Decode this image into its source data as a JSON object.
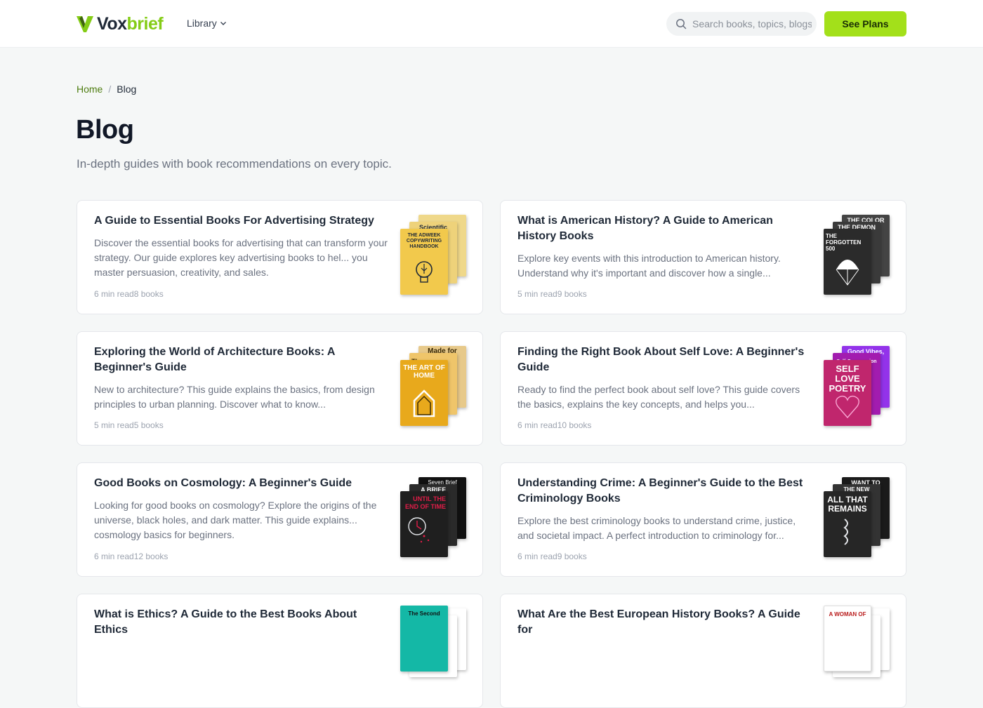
{
  "header": {
    "logo": {
      "part1": "Vox",
      "part2": "brief"
    },
    "nav_library": "Library",
    "search_placeholder": "Search books, topics, blogs",
    "cta_label": "See Plans"
  },
  "breadcrumb": {
    "home": "Home",
    "separator": "/",
    "current": "Blog"
  },
  "page": {
    "title": "Blog",
    "subtitle": "In-depth guides with book recommendations on every topic."
  },
  "colors": {
    "accent": "#a3e01a",
    "brand_green": "#84cc16",
    "link_green": "#4d7c0f"
  },
  "cards": [
    {
      "title": "A Guide to Essential Books For Advertising Strategy",
      "description": "Discover the essential books for advertising that can transform your strategy. Our guide explores key advertising books to hel... you master persuasion, creativity, and sales.",
      "meta": "6 min read8 books",
      "covers": [
        {
          "title": "THE ADWEEK COPYWRITING HANDBOOK",
          "bg": "#f2c94c",
          "fg": "#1f2937",
          "icon": "lightbulb-icon"
        },
        {
          "title": "Scientific",
          "bg": "#eed27a",
          "fg": "#1f2937"
        },
        {
          "title": "",
          "bg": "#efd88a",
          "fg": "#1f2937"
        }
      ]
    },
    {
      "title": "What is American History? A Guide to American History Books",
      "description": "Explore key events with this introduction to American history. Understand why it's important and discover how a single...",
      "meta": "5 min read9 books",
      "covers": [
        {
          "title": "THE FORGOTTEN 500",
          "bg": "#2b2b2b",
          "fg": "#ffffff",
          "icon": "parachute-icon"
        },
        {
          "title": "THE DEMON",
          "bg": "#3a3a3a",
          "fg": "#ffffff"
        },
        {
          "title": "THE COLOR",
          "bg": "#444444",
          "fg": "#ffffff"
        }
      ]
    },
    {
      "title": "Exploring the World of Architecture Books: A Beginner's Guide",
      "description": "New to architecture? This guide explains the basics, from design principles to urban planning. Discover what to know...",
      "meta": "5 min read5 books",
      "covers": [
        {
          "title": "THE ART OF HOME",
          "bg": "#e8a91c",
          "fg": "#3b2a05",
          "icon": "house-icon"
        },
        {
          "title": "The",
          "bg": "#efc56a",
          "fg": "#3b2a05"
        },
        {
          "title": "Made for",
          "bg": "#e7c98a",
          "fg": "#3b2a05"
        }
      ]
    },
    {
      "title": "Finding the Right Book About Self Love: A Beginner's Guide",
      "description": "Ready to find the perfect book about self love? This guide covers the basics, explains the key concepts, and helps you...",
      "meta": "6 min read10 books",
      "covers": [
        {
          "title": "SELF LOVE POETRY",
          "bg": "#c0266d",
          "fg": "#ffffff",
          "icon": "heart-icon"
        },
        {
          "title": "Self-Compassion",
          "bg": "#a21caf",
          "fg": "#ffffff"
        },
        {
          "title": "Good Vibes,",
          "bg": "#9333ea",
          "fg": "#ffffff"
        }
      ]
    },
    {
      "title": "Good Books on Cosmology: A Beginner's Guide",
      "description": "Looking for good books on cosmology? Explore the origins of the universe, black holes, and dark matter. This guide explains... cosmology basics for beginners.",
      "meta": "6 min read12 books",
      "covers": [
        {
          "title": "UNTIL THE END OF TIME",
          "bg": "#1f1f1f",
          "fg": "#e11d48",
          "icon": "clock-icon"
        },
        {
          "title": "A BRIEF",
          "bg": "#2a2a2a",
          "fg": "#ffffff"
        },
        {
          "title": "Seven Brief",
          "bg": "#111111",
          "fg": "#ffffff"
        }
      ]
    },
    {
      "title": "Understanding Crime: A Beginner's Guide to the Best Criminology Books",
      "description": "Explore the best criminology books to understand crime, justice, and societal impact. A perfect introduction to criminology for...",
      "meta": "6 min read9 books",
      "covers": [
        {
          "title": "ALL THAT REMAINS",
          "bg": "#262626",
          "fg": "#ffffff",
          "icon": "spine-icon"
        },
        {
          "title": "THE NEW",
          "bg": "#333333",
          "fg": "#ffffff"
        },
        {
          "title": "WANT TO",
          "bg": "#1a1a1a",
          "fg": "#ffffff"
        }
      ]
    },
    {
      "title": "What is Ethics? A Guide to the Best Books About Ethics",
      "description": "",
      "meta": "",
      "covers": [
        {
          "title": "",
          "bg": "#ffffff",
          "fg": "#111111"
        },
        {
          "title": "",
          "bg": "#ffffff",
          "fg": "#111111"
        },
        {
          "title": "The Second",
          "bg": "#14b8a6",
          "fg": "#111111"
        }
      ]
    },
    {
      "title": "What Are the Best European History Books? A Guide for",
      "description": "",
      "meta": "",
      "covers": [
        {
          "title": "",
          "bg": "#ffffff",
          "fg": "#111111"
        },
        {
          "title": "",
          "bg": "#ffffff",
          "fg": "#111111"
        },
        {
          "title": "A WOMAN OF",
          "bg": "#ffffff",
          "fg": "#b91c1c"
        }
      ]
    }
  ]
}
